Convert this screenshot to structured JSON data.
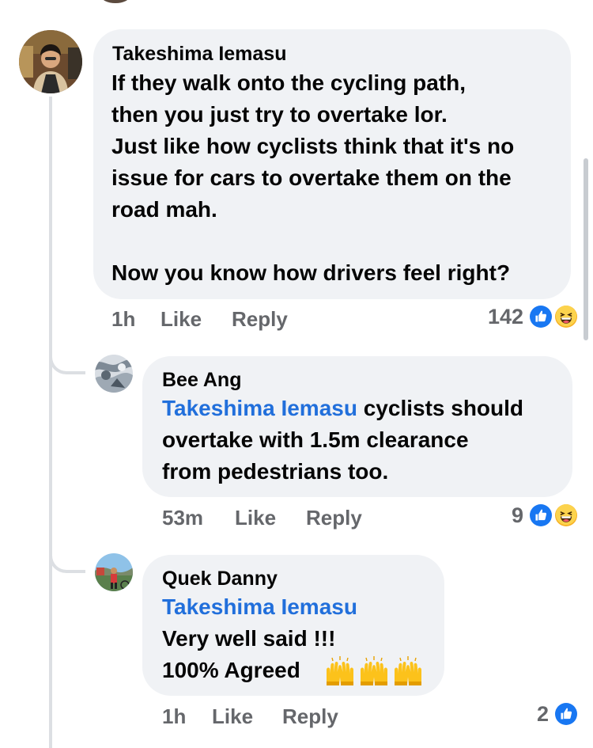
{
  "comments": [
    {
      "author": "Takeshima Iemasu",
      "lines": [
        "If they walk onto the cycling path,",
        "then you just try to overtake lor.",
        "Just like how cyclists think that it's no",
        "issue for cars to overtake them on the",
        "road mah.",
        "Now you know how drivers feel right?"
      ],
      "time": "1h",
      "like_label": "Like",
      "reply_label": "Reply",
      "reaction_count": "142",
      "reactions": [
        "like-icon",
        "haha-icon"
      ]
    },
    {
      "author": "Bee Ang",
      "mention": "Takeshima Iemasu",
      "lines": [
        " cyclists should",
        "overtake with 1.5m clearance",
        "from pedestrians too."
      ],
      "time": "53m",
      "like_label": "Like",
      "reply_label": "Reply",
      "reaction_count": "9",
      "reactions": [
        "like-icon",
        "haha-icon"
      ]
    },
    {
      "author": "Quek Danny",
      "mention": "Takeshima Iemasu",
      "lines": [
        "Very well said !!!",
        "100% Agreed"
      ],
      "emoji": [
        "raising-hands-icon",
        "raising-hands-icon",
        "raising-hands-icon"
      ],
      "time": "1h",
      "like_label": "Like",
      "reply_label": "Reply",
      "reaction_count": "2",
      "reactions": [
        "like-icon"
      ]
    }
  ],
  "colors": {
    "bubble": "#f0f2f5",
    "mention": "#216fdb",
    "meta": "#65676b",
    "like_blue": "#1877f2",
    "thread_line": "#dcdfe3"
  }
}
